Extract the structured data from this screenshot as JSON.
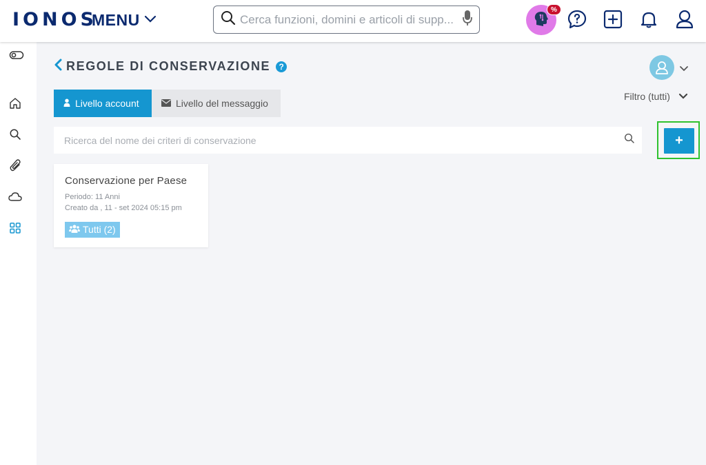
{
  "header": {
    "logo": "IONOS",
    "menu_label": "MENU",
    "search_placeholder": "Cerca funzioni, domini e articoli di supp...",
    "promo_badge": "%"
  },
  "page": {
    "title": "REGOLE DI CONSERVAZIONE",
    "help_glyph": "?"
  },
  "tabs": [
    {
      "label": "Livello account",
      "icon": "user-icon",
      "active": true
    },
    {
      "label": "Livello del messaggio",
      "icon": "envelope-icon",
      "active": false
    }
  ],
  "filter": {
    "label": "Filtro (tutti)"
  },
  "policy_search": {
    "placeholder": "Ricerca del nome dei criteri di conservazione"
  },
  "add_button": {
    "label": "+"
  },
  "cards": [
    {
      "title": "Conservazione per Paese",
      "period": "Periodo: 11 Anni",
      "created": "Creato da , 11 - set 2024 05:15 pm",
      "badge": "Tutti (2)"
    }
  ],
  "colors": {
    "brand": "#0b2a6f",
    "accent": "#1596d0",
    "highlight": "#2ec22e",
    "badge": "#7ec8ee",
    "promo": "#e07ae8"
  }
}
